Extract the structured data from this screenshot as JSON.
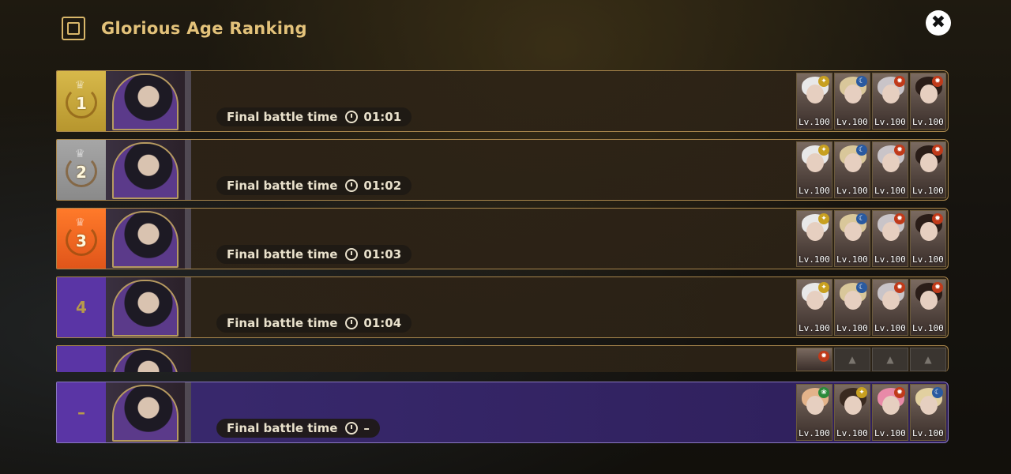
{
  "header": {
    "title": "Glorious Age Ranking",
    "icon": "emblem-icon"
  },
  "close_label": "✖",
  "battle_label": "Final battle time",
  "rows": [
    {
      "rank": "1",
      "time": "01:01",
      "team": [
        {
          "lv": "Lv.100",
          "element": "light",
          "hair": "#e8e8e8"
        },
        {
          "lv": "Lv.100",
          "element": "moon",
          "hair": "#d9c79a"
        },
        {
          "lv": "Lv.100",
          "element": "fire",
          "hair": "#c9c4c8"
        },
        {
          "lv": "Lv.100",
          "element": "fire",
          "hair": "#2a1d18"
        }
      ]
    },
    {
      "rank": "2",
      "time": "01:02",
      "team": [
        {
          "lv": "Lv.100",
          "element": "light",
          "hair": "#e8e8e8"
        },
        {
          "lv": "Lv.100",
          "element": "moon",
          "hair": "#d9c79a"
        },
        {
          "lv": "Lv.100",
          "element": "fire",
          "hair": "#c9c4c8"
        },
        {
          "lv": "Lv.100",
          "element": "fire",
          "hair": "#2a1d18"
        }
      ]
    },
    {
      "rank": "3",
      "time": "01:03",
      "team": [
        {
          "lv": "Lv.100",
          "element": "light",
          "hair": "#e8e8e8"
        },
        {
          "lv": "Lv.100",
          "element": "moon",
          "hair": "#d9c79a"
        },
        {
          "lv": "Lv.100",
          "element": "fire",
          "hair": "#c9c4c8"
        },
        {
          "lv": "Lv.100",
          "element": "fire",
          "hair": "#2a1d18"
        }
      ]
    },
    {
      "rank": "4",
      "time": "01:04",
      "team": [
        {
          "lv": "Lv.100",
          "element": "light",
          "hair": "#e8e8e8"
        },
        {
          "lv": "Lv.100",
          "element": "moon",
          "hair": "#d9c79a"
        },
        {
          "lv": "Lv.100",
          "element": "fire",
          "hair": "#c9c4c8"
        },
        {
          "lv": "Lv.100",
          "element": "fire",
          "hair": "#2a1d18"
        }
      ]
    }
  ],
  "my_row": {
    "rank": "–",
    "time": "–",
    "team": [
      {
        "lv": "Lv.100",
        "element": "nature",
        "hair": "#e3b38a"
      },
      {
        "lv": "Lv.100",
        "element": "light",
        "hair": "#3a2a20"
      },
      {
        "lv": "Lv.100",
        "element": "fire",
        "hair": "#e88aa8"
      },
      {
        "lv": "Lv.100",
        "element": "moon",
        "hair": "#e2d0a0"
      }
    ]
  },
  "colors": {
    "gold": "#d7b84a",
    "silver": "#a6a6a6",
    "bronze": "#ff7a2a",
    "purple": "#5a35a5",
    "title": "#e3c27a"
  }
}
